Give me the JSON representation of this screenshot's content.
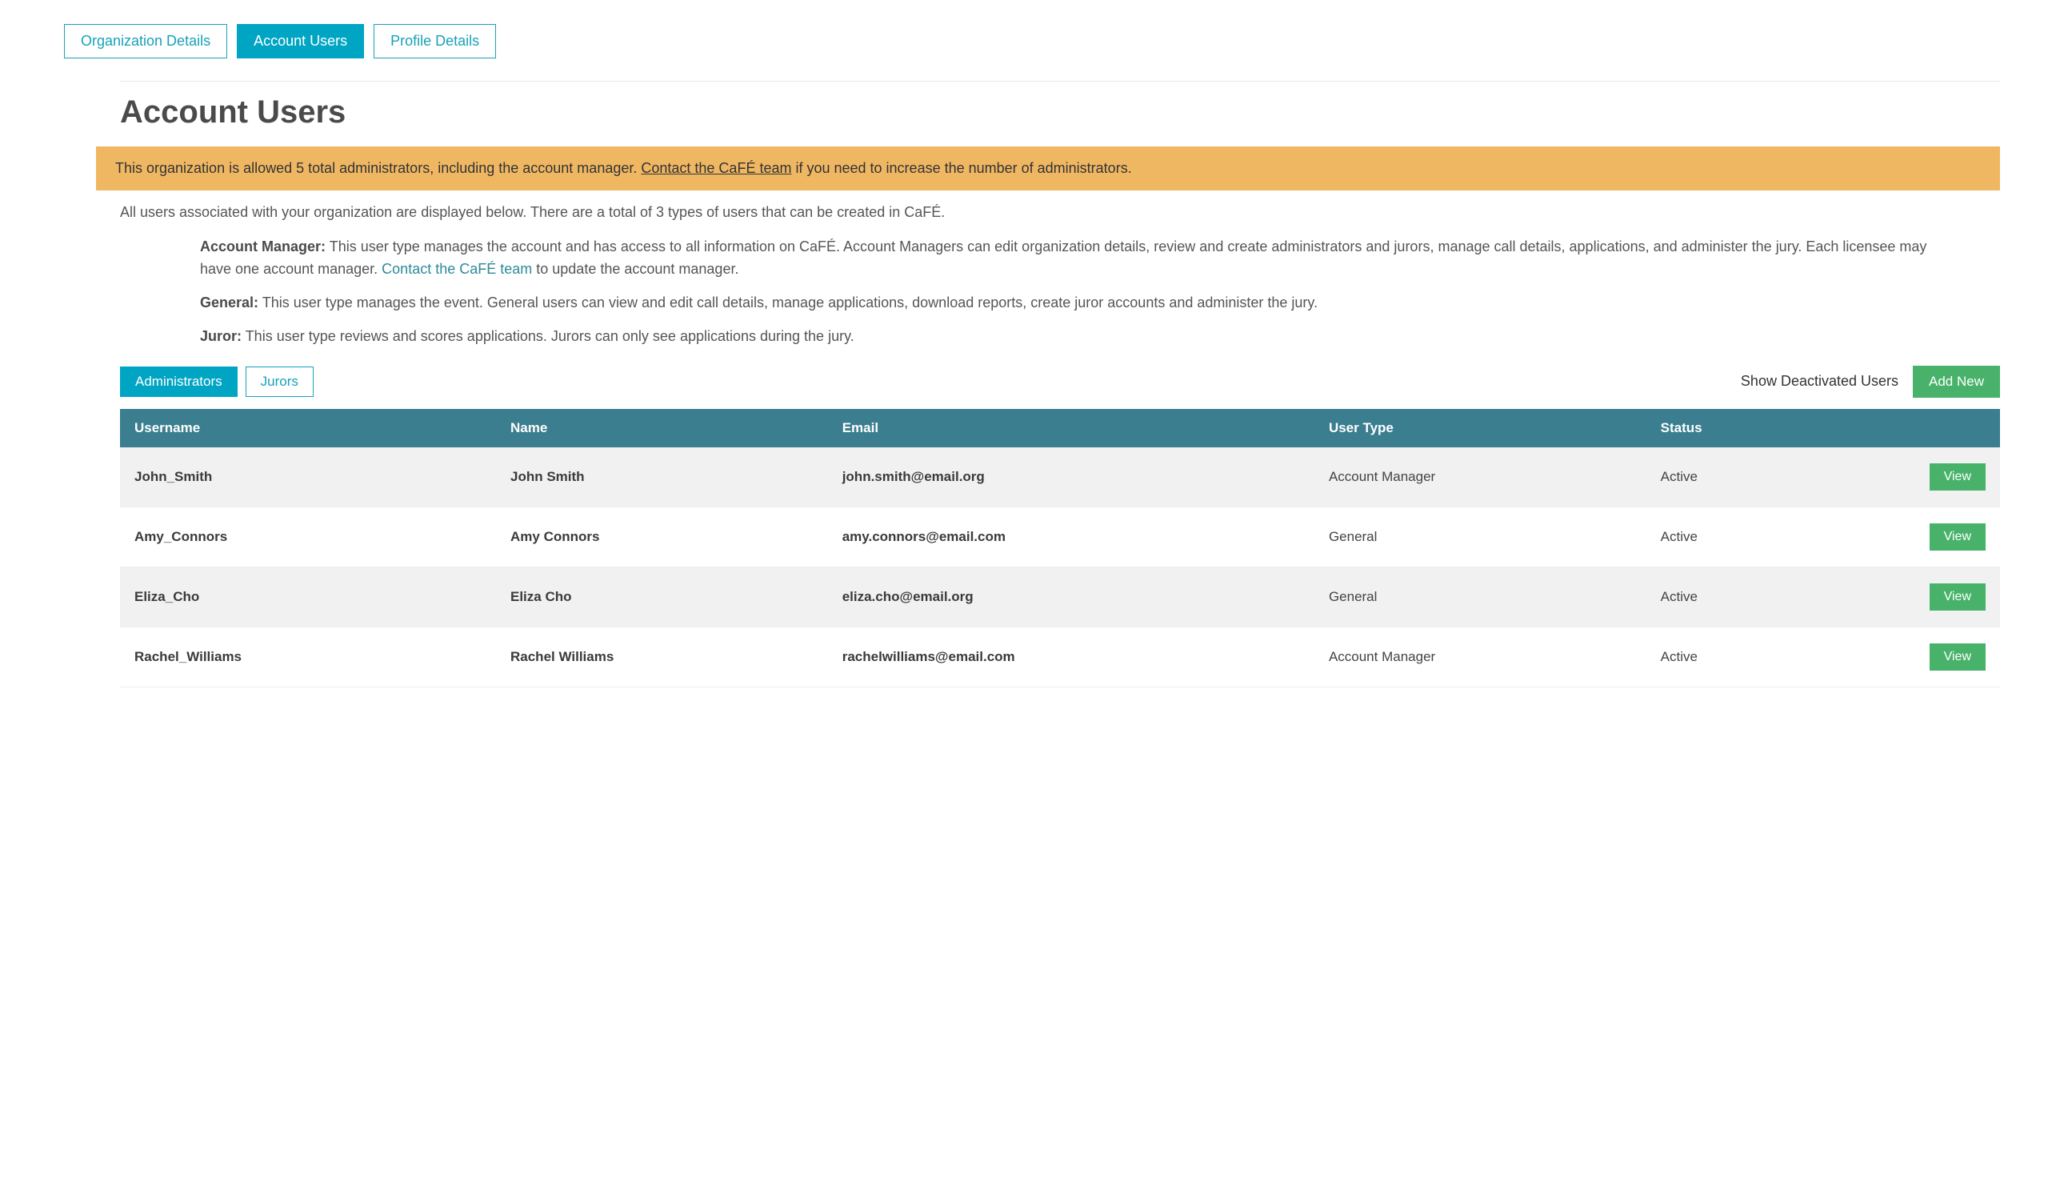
{
  "tabs": [
    {
      "label": "Organization Details",
      "active": false
    },
    {
      "label": "Account Users",
      "active": true
    },
    {
      "label": "Profile Details",
      "active": false
    }
  ],
  "page_title": "Account Users",
  "alert": {
    "part1": "This organization is allowed 5 total administrators, including the account manager. ",
    "link_text": "Contact the CaFÉ team",
    "part2": " if you need to increase the number of administrators."
  },
  "intro": "All users associated with your organization are displayed below. There are a total of 3 types of users that can be created in CaFÉ.",
  "definitions": {
    "account_manager": {
      "label": "Account Manager:",
      "text1": " This user type manages the account and has access to all information on CaFÉ. Account Managers can edit organization details, review and create administrators and jurors, manage call details, applications, and administer the jury. Each licensee may have one account manager. ",
      "link": "Contact the CaFÉ team",
      "text2": " to update the account manager."
    },
    "general": {
      "label": "General:",
      "text": " This user type manages the event. General users can view and edit call details, manage applications, download reports, create juror accounts and administer the jury."
    },
    "juror": {
      "label": "Juror:",
      "text": " This user type reviews and scores applications. Jurors can only see applications during the jury."
    }
  },
  "sub_tabs": [
    {
      "label": "Administrators",
      "active": true
    },
    {
      "label": "Jurors",
      "active": false
    }
  ],
  "show_deactivated_label": "Show Deactivated Users",
  "add_new_label": "Add New",
  "table": {
    "headers": [
      "Username",
      "Name",
      "Email",
      "User Type",
      "Status"
    ],
    "rows": [
      {
        "username": "John_Smith",
        "name": "John Smith",
        "email": "john.smith@email.org",
        "user_type": "Account Manager",
        "status": "Active",
        "action": "View"
      },
      {
        "username": "Amy_Connors",
        "name": "Amy Connors",
        "email": "amy.connors@email.com",
        "user_type": "General",
        "status": "Active",
        "action": "View"
      },
      {
        "username": "Eliza_Cho",
        "name": "Eliza Cho",
        "email": "eliza.cho@email.org",
        "user_type": "General",
        "status": "Active",
        "action": "View"
      },
      {
        "username": "Rachel_Williams",
        "name": "Rachel Williams",
        "email": "rachelwilliams@email.com",
        "user_type": "Account Manager",
        "status": "Active",
        "action": "View"
      }
    ]
  }
}
